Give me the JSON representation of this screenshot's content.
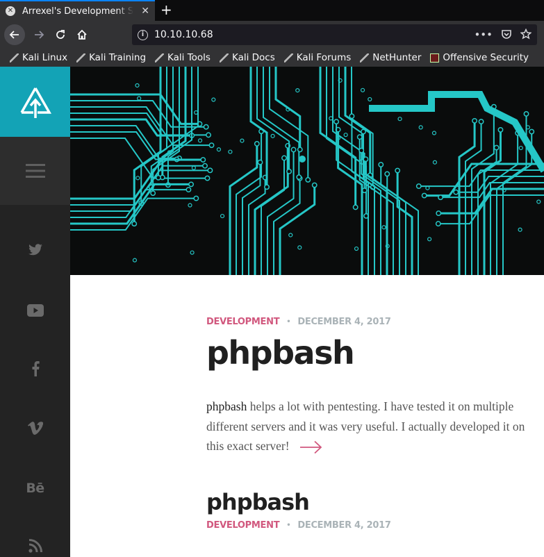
{
  "browser": {
    "tab_title": "Arrexel's Development S",
    "url": "10.10.10.68",
    "bookmarks": [
      {
        "label": "Kali Linux",
        "icon": "kali-dragon-icon"
      },
      {
        "label": "Kali Training",
        "icon": "kali-dragon-icon"
      },
      {
        "label": "Kali Tools",
        "icon": "kali-dragon-icon"
      },
      {
        "label": "Kali Docs",
        "icon": "kali-dragon-icon"
      },
      {
        "label": "Kali Forums",
        "icon": "kali-dragon-icon"
      },
      {
        "label": "NetHunter",
        "icon": "nethunter-icon"
      },
      {
        "label": "Offensive Security",
        "icon": "offensive-security-icon"
      }
    ]
  },
  "sidebar": {
    "accent_color": "#13a3b6",
    "social_icons": [
      "twitter-icon",
      "youtube-icon",
      "facebook-icon",
      "vimeo-icon",
      "behance-icon",
      "rss-icon"
    ],
    "behance_text": "Bē"
  },
  "posts": [
    {
      "category": "DEVELOPMENT",
      "date": "DECEMBER 4, 2017",
      "title": "phpbash",
      "excerpt_strong": "phpbash",
      "excerpt_rest": " helps a lot with pentesting. I have tested it on multiple different servers and it was very useful. I actually developed it on this exact server!"
    },
    {
      "category": "DEVELOPMENT",
      "date": "DECEMBER 4, 2017",
      "title": "phpbash"
    }
  ],
  "colors": {
    "category": "#d1587e",
    "date": "#aab3b7",
    "circuit": "#25c7c7"
  }
}
